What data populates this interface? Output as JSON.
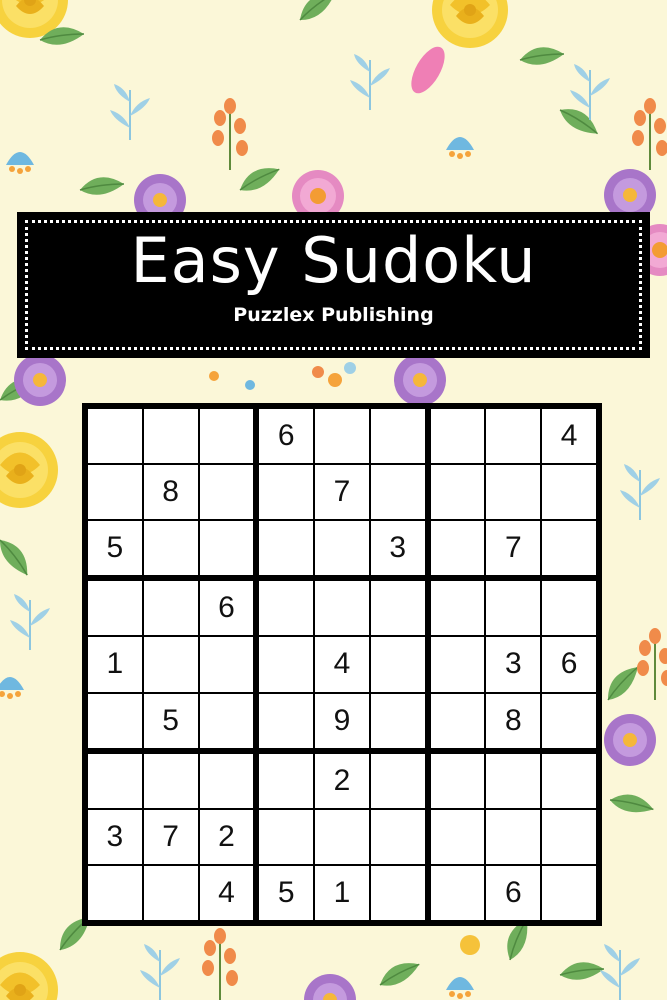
{
  "cover": {
    "title": "Easy Sudoku",
    "publisher": "Puzzlex Publishing"
  },
  "colors": {
    "background": "#fbf7d8",
    "banner": "#000000",
    "banner_text": "#ffffff",
    "grid_lines": "#000000",
    "cell": "#ffffff"
  },
  "puzzle": {
    "rows": [
      [
        "",
        "",
        "",
        "6",
        "",
        "",
        "",
        "",
        "4"
      ],
      [
        "",
        "8",
        "",
        "",
        "7",
        "",
        "",
        "",
        ""
      ],
      [
        "5",
        "",
        "",
        "",
        "",
        "3",
        "",
        "7",
        ""
      ],
      [
        "",
        "",
        "6",
        "",
        "",
        "",
        "",
        "",
        ""
      ],
      [
        "1",
        "",
        "",
        "",
        "4",
        "",
        "",
        "3",
        "6"
      ],
      [
        "",
        "5",
        "",
        "",
        "9",
        "",
        "",
        "8",
        ""
      ],
      [
        "",
        "",
        "",
        "",
        "2",
        "",
        "",
        "",
        ""
      ],
      [
        "3",
        "7",
        "2",
        "",
        "",
        "",
        "",
        "",
        ""
      ],
      [
        "",
        "",
        "4",
        "5",
        "1",
        "",
        "",
        "6",
        ""
      ]
    ]
  },
  "background_motifs": [
    "yellow-rose-icon",
    "pink-daisy-icon",
    "purple-daisy-icon",
    "orange-berry-sprig-icon",
    "blue-leaf-sprig-icon",
    "green-leaf-icon"
  ]
}
